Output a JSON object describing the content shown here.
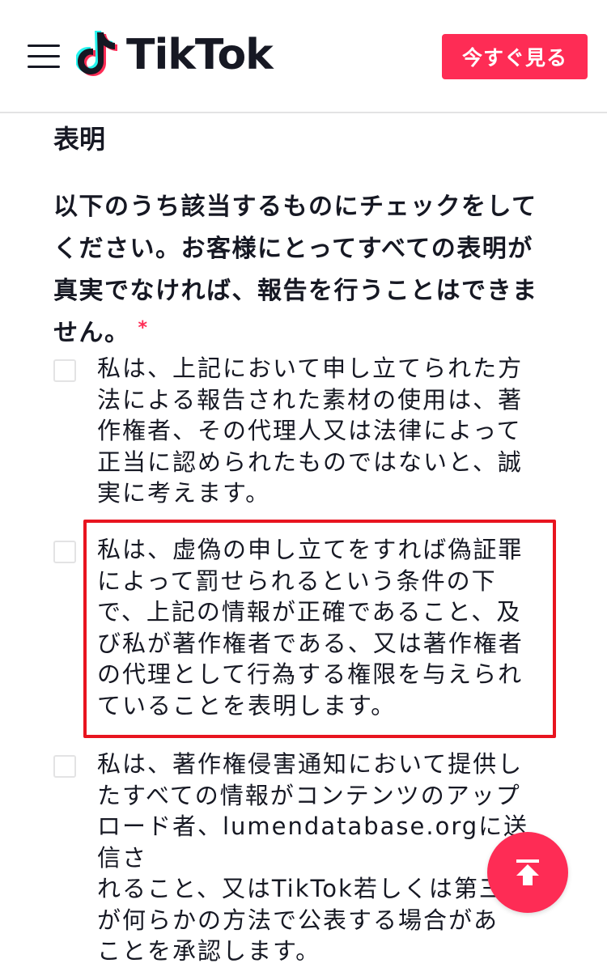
{
  "header": {
    "app_name": "TikTok",
    "watch_now_label": "今すぐ見る"
  },
  "colors": {
    "brand_accent": "#fe2c55",
    "highlight_border": "#e8141f",
    "text": "#161823"
  },
  "icons": {
    "menu": "hamburger-menu-icon",
    "logo": "tiktok-note-icon",
    "scroll_top": "arrow-up-to-top-icon"
  },
  "form": {
    "section_title": "表明",
    "instruction": "以下のうち該当するものにチェックをしてください。お客様にとってすべての表明が真実でなければ、報告を行うことはできません。",
    "required_mark": "*",
    "options": [
      {
        "checked": false,
        "lines": [
          "私は、上記において申し立てられた方",
          "法による報告された素材の使用は、著",
          "作権者、その代理人又は法律によって",
          "正当に認められたものではないと、誠",
          "実に考えます。"
        ]
      },
      {
        "checked": false,
        "lines": [
          "私は、虚偽の申し立てをすれば偽証罪",
          "によって罰せられるという条件の下",
          "で、上記の情報が正確であること、及",
          "び私が著作権者である、又は著作権者",
          "の代理として行為する権限を与えられ",
          "ていることを表明します。"
        ]
      },
      {
        "checked": false,
        "lines": [
          "私は、著作権侵害通知において提供し",
          "たすべての情報がコンテンツのアップ",
          "ロード者、lumendatabase.orgに送信さ",
          "れること、又はTikTok若しくは第三者",
          "が何らかの方法で公表する場合があ",
          "ことを承認します。"
        ]
      }
    ]
  }
}
